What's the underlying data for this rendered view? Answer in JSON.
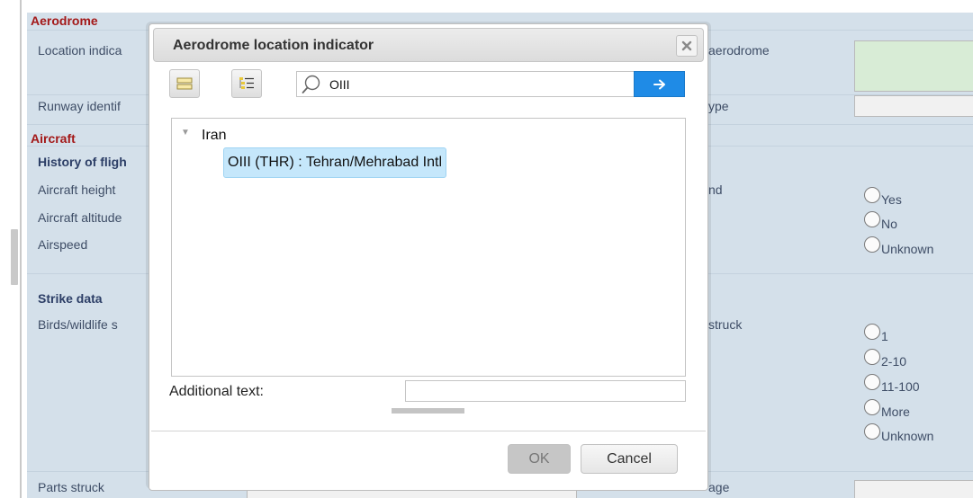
{
  "form": {
    "sections": {
      "aerodrome": "Aerodrome",
      "aircraft": "Aircraft",
      "history_of_flight": "History of fligh",
      "strike_data": "Strike data"
    },
    "left_labels": {
      "location_indicator": "Location indica",
      "runway_identifier": "Runway identif",
      "aircraft_height": "Aircraft height",
      "aircraft_altitude": "Aircraft altitude",
      "airspeed": "Airspeed",
      "birds_wildlife": "Birds/wildlife s",
      "parts_struck": "Parts struck"
    },
    "right_labels": {
      "aerodrome": "aerodrome",
      "type": "ype",
      "nd": "nd",
      "struck": "struck",
      "damage": "age"
    },
    "radio_group_1": [
      "Yes",
      "No",
      "Unknown"
    ],
    "radio_group_2": [
      "1",
      "2-10",
      "11-100",
      "More",
      "Unknown"
    ]
  },
  "dialog": {
    "title": "Aerodrome location indicator",
    "search": {
      "value": "OIII",
      "placeholder": ""
    },
    "tree": {
      "country": "Iran",
      "selected_item": "OIII (THR) : Tehran/Mehrabad Intl"
    },
    "additional_text_label": "Additional text:",
    "additional_text_value": "",
    "ok_label": "OK",
    "cancel_label": "Cancel"
  },
  "icons": {
    "close": "close-icon",
    "list_view": "list-view-icon",
    "tree_view": "tree-view-icon",
    "search": "search-icon",
    "go": "arrow-right-icon"
  },
  "colors": {
    "form_bg": "#d4e0ea",
    "section_red": "#a31818",
    "accent_blue": "#1f8be6",
    "selection": "#c5e7fb"
  }
}
